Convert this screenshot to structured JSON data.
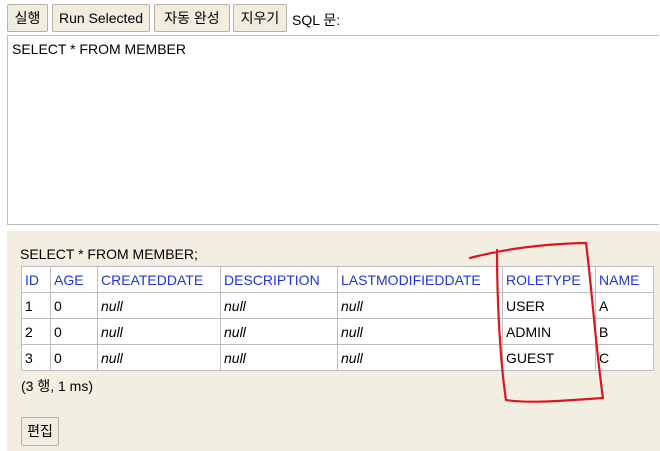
{
  "toolbar": {
    "run_label": "실행",
    "run_selected_label": "Run Selected",
    "autocomplete_label": "자동 완성",
    "clear_label": "지우기",
    "sql_label": "SQL 문:"
  },
  "editor": {
    "text": "SELECT * FROM MEMBER"
  },
  "results": {
    "query": "SELECT * FROM MEMBER;",
    "columns": [
      "ID",
      "AGE",
      "CREATEDDATE",
      "DESCRIPTION",
      "LASTMODIFIEDDATE",
      "ROLETYPE",
      "NAME"
    ],
    "rows": [
      [
        "1",
        "0",
        "null",
        "null",
        "null",
        "USER",
        "A"
      ],
      [
        "2",
        "0",
        "null",
        "null",
        "null",
        "ADMIN",
        "B"
      ],
      [
        "3",
        "0",
        "null",
        "null",
        "null",
        "GUEST",
        "C"
      ]
    ],
    "count_text": "(3 행, 1 ms)",
    "edit_label": "편집"
  },
  "colors": {
    "panel_bg": "#f2efe2",
    "header_text": "#2233dd",
    "annotation": "#e0141e"
  }
}
